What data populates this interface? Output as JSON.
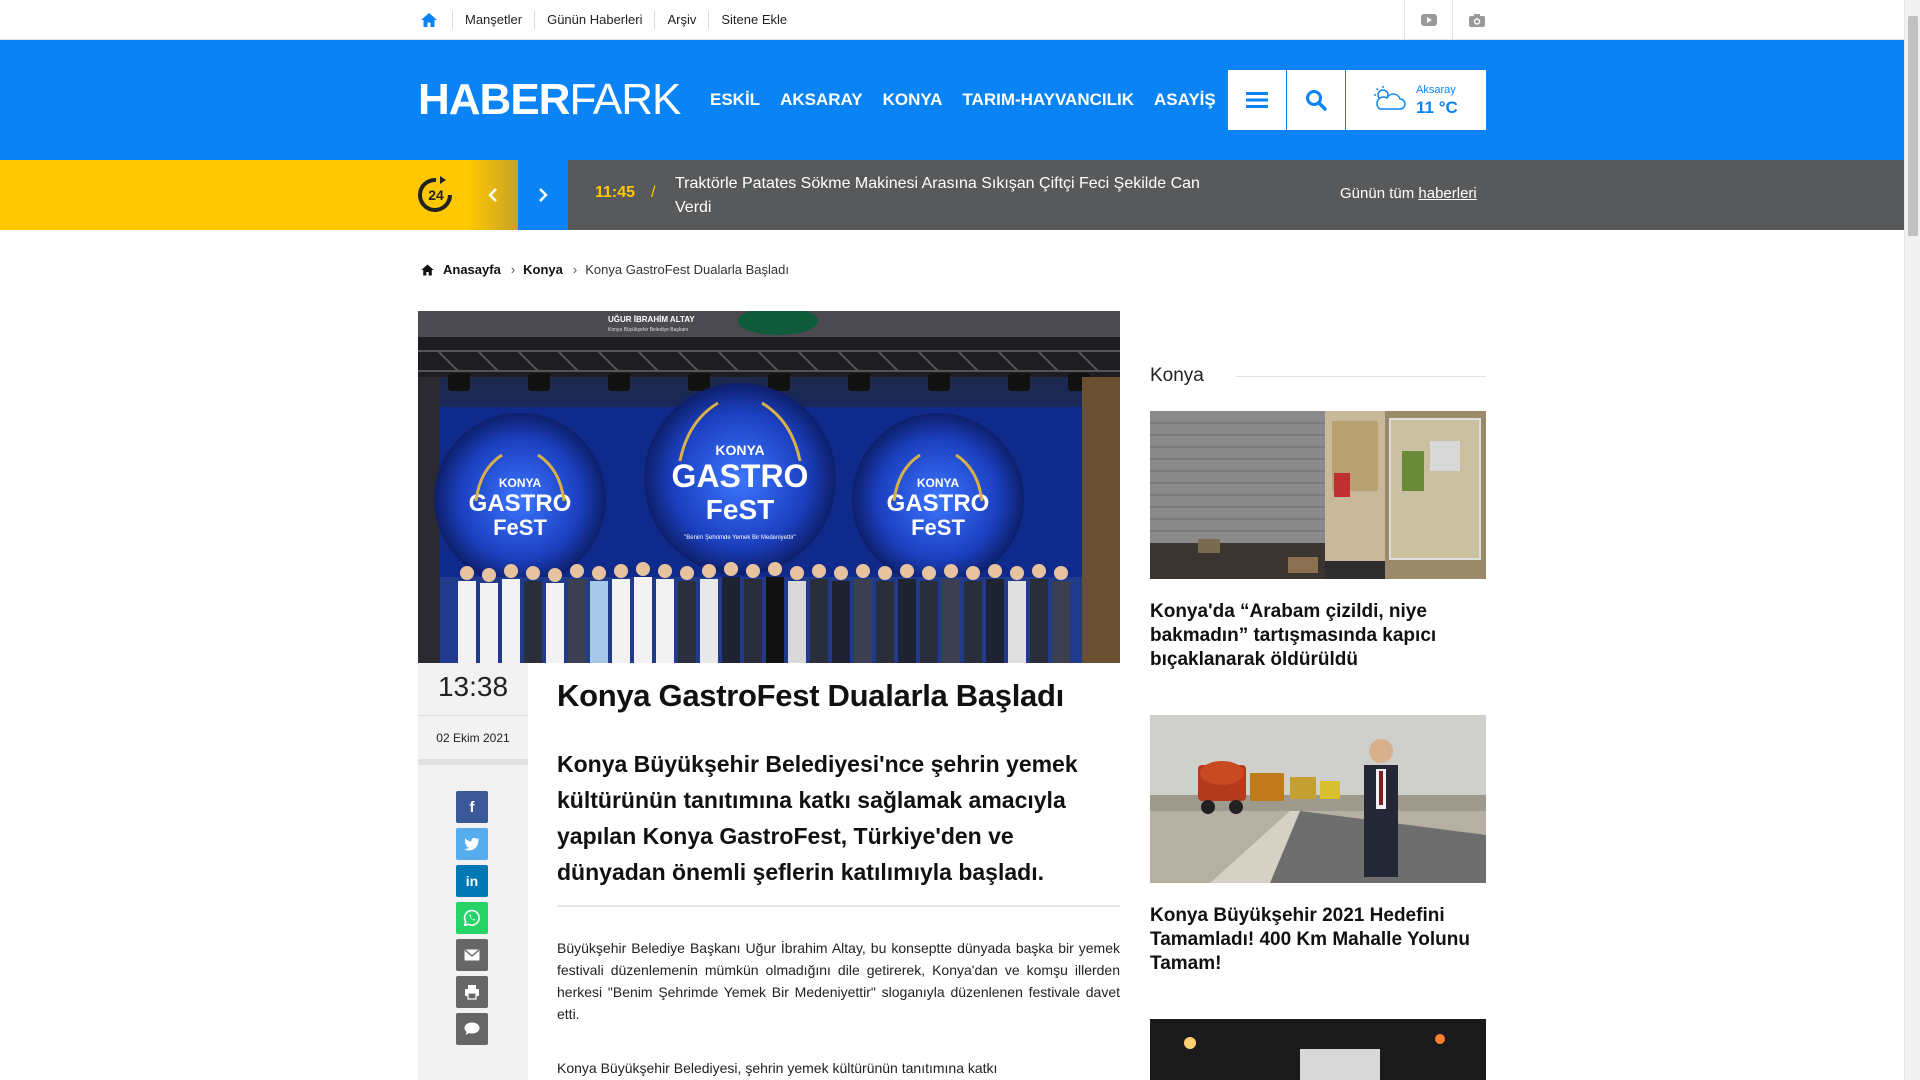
{
  "topbar": {
    "links": [
      "Manşetler",
      "Günün Haberleri",
      "Arşiv",
      "Sitene Ekle"
    ]
  },
  "header": {
    "logo_bold": "HABER",
    "logo_light": "FARK",
    "nav": [
      "ESKİL",
      "AKSARAY",
      "KONYA",
      "TARIM-HAYVANCILIK",
      "ASAYİŞ"
    ],
    "weather": {
      "city": "Aksaray",
      "temp": "11 °C"
    }
  },
  "breaking": {
    "clock_label": "24",
    "time": "11:45",
    "separator": "/",
    "title": "Traktörle Patates Sökme Makinesi Arasına Sıkışan Çiftçi Feci Şekilde Can Verdi",
    "all_prefix": "Günün tüm ",
    "all_link": "haberleri"
  },
  "breadcrumb": {
    "home": "Anasayfa",
    "category": "Konya",
    "current": "Konya GastroFest Dualarla Başladı"
  },
  "article": {
    "hero_banner_line": "UĞUR İBRAHİM ALTAY",
    "hero_banner_sub": "Konya Büyükşehir Belediye Başkanı",
    "hero_logo_top": "KONYA",
    "hero_logo_mid": "GASTRO",
    "hero_logo_bot": "FeST",
    "hero_slogan": "\"Benim Şehrimde Yemek Bir Medeniyettir\"",
    "time": "13:38",
    "date": "02 Ekim 2021",
    "title": "Konya GastroFest Dualarla Başladı",
    "lead": "Konya Büyükşehir Belediyesi'nce şehrin yemek kültürünün tanıtımına katkı sağlamak amacıyla yapılan Konya GastroFest, Türkiye'den ve dünyadan önemli şeflerin katılımıyla başladı.",
    "p1": "Büyükşehir Belediye Başkanı Uğur İbrahim Altay, bu konseptte dünyada başka bir yemek festivali düzenlemenin mümkün olmadığını dile getirerek, Konya'dan ve komşu illerden herkesi \"Benim Şehrimde Yemek Bir Medeniyettir\" sloganıyla düzenlenen festivale davet etti.",
    "p2": "Konya Büyükşehir Belediyesi, şehrin yemek kültürünün tanıtımına katkı"
  },
  "share": [
    {
      "name": "facebook",
      "glyph": "f",
      "color": "#3b5998"
    },
    {
      "name": "twitter",
      "glyph": "t",
      "color": "#55acee"
    },
    {
      "name": "linkedin",
      "glyph": "in",
      "color": "#0077b5"
    },
    {
      "name": "whatsapp",
      "glyph": "w",
      "color": "#25d366"
    },
    {
      "name": "email",
      "glyph": "✉",
      "color": "#666666"
    },
    {
      "name": "print",
      "glyph": "⎙",
      "color": "#666666"
    },
    {
      "name": "comment",
      "glyph": "💬",
      "color": "#666666"
    }
  ],
  "sidebar": {
    "heading": "Konya",
    "items": [
      {
        "title": "Konya'da “Arabam çizildi, niye bakmadın” tartışmasında kapıcı bıçaklanarak öldürüldü"
      },
      {
        "title": "Konya Büyükşehir 2021 Hedefini Tamamladı! 400 Km Mahalle Yolunu Tamam!"
      }
    ]
  },
  "colors": {
    "brand_blue": "#0a84f5",
    "ticker_yellow": "#ffc800",
    "ticker_gray": "#58595b"
  }
}
